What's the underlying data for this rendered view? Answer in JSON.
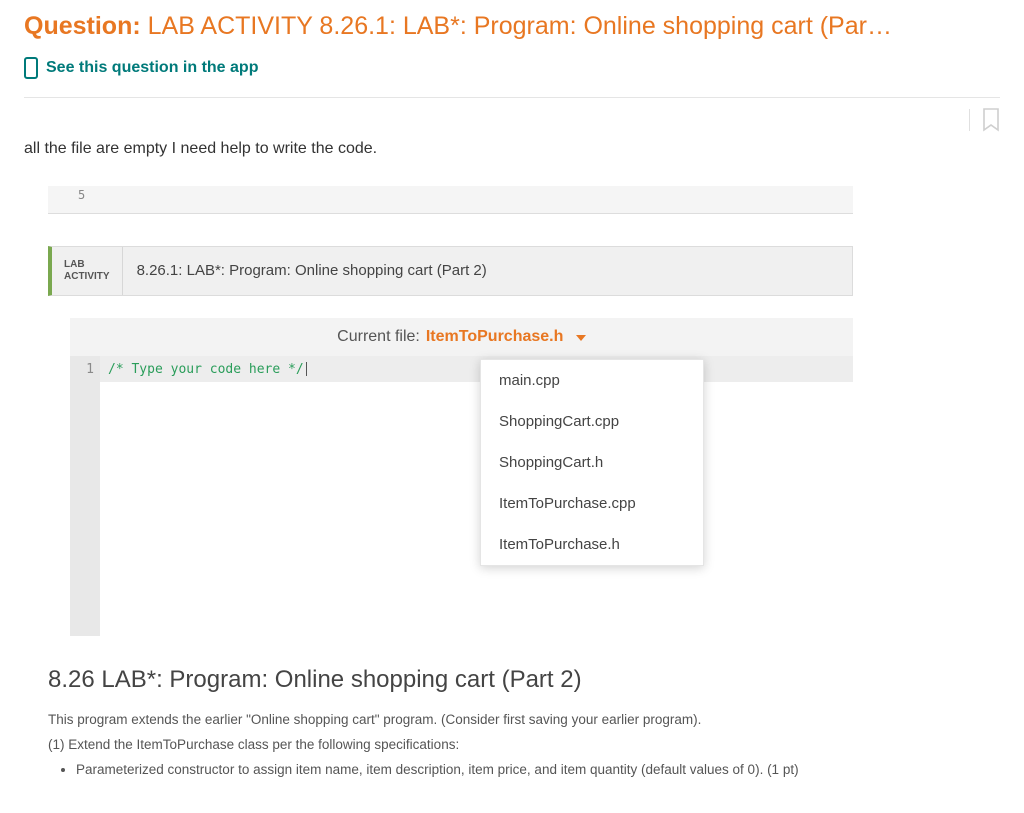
{
  "header": {
    "question_label": "Question: ",
    "question_text": "LAB ACTIVITY 8.26.1: LAB*: Program: Online shopping cart (Par…",
    "see_in_app": "See this question in the app"
  },
  "body": {
    "intro_text": "all the file are empty I need help to write the code."
  },
  "lab": {
    "sliver_number": "5",
    "badge_line1": "LAB",
    "badge_line2": "ACTIVITY",
    "title": "8.26.1: LAB*: Program: Online shopping cart (Part 2)",
    "current_file_label": "Current file:",
    "current_file_name": "ItemToPurchase.h",
    "dropdown_items": [
      "main.cpp",
      "ShoppingCart.cpp",
      "ShoppingCart.h",
      "ItemToPurchase.cpp",
      "ItemToPurchase.h"
    ],
    "code_line_number": "1",
    "code_comment": "/* Type your code here */"
  },
  "description": {
    "heading": "8.26 LAB*: Program: Online shopping cart (Part 2)",
    "p1": "This program extends the earlier \"Online shopping cart\" program. (Consider first saving your earlier program).",
    "p2": "(1) Extend the ItemToPurchase class per the following specifications:",
    "bullet1": "Parameterized constructor to assign item name, item description, item price, and item quantity (default values of 0). (1 pt)"
  }
}
